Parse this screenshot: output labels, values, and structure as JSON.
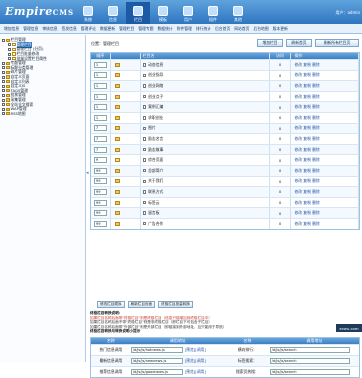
{
  "header": {
    "logo_main": "Empire",
    "logo_sub": "CMS",
    "user": "用户：admin",
    "nav": [
      {
        "label": "系统",
        "icon": "system-icon"
      },
      {
        "label": "信息",
        "icon": "info-icon"
      },
      {
        "label": "栏目",
        "icon": "column-icon"
      },
      {
        "label": "模板",
        "icon": "template-icon"
      },
      {
        "label": "用户",
        "icon": "user-icon"
      },
      {
        "label": "插件",
        "icon": "plugin-icon"
      },
      {
        "label": "其他",
        "icon": "other-icon"
      }
    ],
    "active_index": 2
  },
  "subnav": [
    "增加信息",
    "管理信息",
    "审核信息",
    "签发信息",
    "管理评论",
    "数据更新",
    "管理栏目",
    "管理专题",
    "数据统计",
    "附件管理",
    "排行统计",
    "后台首页",
    "网站首页",
    "后台地图",
    "版本更新"
  ],
  "sidebar": {
    "items": [
      {
        "label": "栏目管理",
        "level": 0,
        "type": "folder"
      },
      {
        "label": "管理栏目",
        "level": 1,
        "type": "doc"
      },
      {
        "label": "管理栏目 (分页)",
        "level": 1,
        "type": "doc"
      },
      {
        "label": "栏目批量修改",
        "level": 1,
        "type": "doc"
      },
      {
        "label": "批量设置栏目属性",
        "level": 1,
        "type": "doc"
      },
      {
        "label": "专题管理",
        "level": 0,
        "type": "folder"
      },
      {
        "label": "标题分类管理",
        "level": 0,
        "type": "folder"
      },
      {
        "label": "碎片管理",
        "level": 0,
        "type": "folder"
      },
      {
        "label": "自定义页面",
        "level": 0,
        "type": "folder"
      },
      {
        "label": "自定义列表",
        "level": 0,
        "type": "folder"
      },
      {
        "label": "自定义JS",
        "level": 0,
        "type": "folder"
      },
      {
        "label": "TAGS管理",
        "level": 0,
        "type": "folder"
      },
      {
        "label": "投票管理",
        "level": 0,
        "type": "folder"
      },
      {
        "label": "采集管理",
        "level": 0,
        "type": "folder"
      },
      {
        "label": "全站全文搜索",
        "level": 0,
        "type": "folder"
      },
      {
        "label": "WAP管理",
        "level": 0,
        "type": "folder"
      },
      {
        "label": "RSS地图",
        "level": 0,
        "type": "folder"
      }
    ]
  },
  "toolbar": {
    "crumb": "位置：管理栏目",
    "btn_add": "增加栏目",
    "btn_refresh": "刷新首页",
    "btn_all": "刷新所有栏目页"
  },
  "grid": {
    "headers": [
      "顺序",
      "",
      "栏目名",
      "访问",
      "操作"
    ],
    "rows": [
      {
        "order": "1",
        "name": "动态信息",
        "visits": "0",
        "ops": "修改 复制 删除"
      },
      {
        "order": "1",
        "name": "创业指导",
        "visits": "0",
        "ops": "修改 复制 删除"
      },
      {
        "order": "1",
        "name": "创业网络",
        "visits": "0",
        "ops": "修改 复制 删除"
      },
      {
        "order": "1",
        "name": "创业点子",
        "visits": "0",
        "ops": "修改 复制 删除"
      },
      {
        "order": "1",
        "name": "案例汇编",
        "visits": "0",
        "ops": "修改 复制 删除"
      },
      {
        "order": "1",
        "name": "求职创业",
        "visits": "0",
        "ops": "修改 复制 删除"
      },
      {
        "order": "7",
        "name": "图片",
        "visits": "0",
        "ops": "修改 复制 删除"
      },
      {
        "order": "7",
        "name": "励志名言",
        "visits": "0",
        "ops": "修改 复制 删除"
      },
      {
        "order": "7",
        "name": "励志故事",
        "visits": "0",
        "ops": "修改 复制 删除"
      },
      {
        "order": "9",
        "name": "综合页面",
        "visits": "0",
        "ops": "修改 复制 删除"
      },
      {
        "order": "99",
        "name": "总部简介",
        "visits": "0",
        "ops": "修改 复制 删除"
      },
      {
        "order": "99",
        "name": "关于我们",
        "visits": "0",
        "ops": "修改 复制 删除"
      },
      {
        "order": "99",
        "name": "联系方式",
        "visits": "0",
        "ops": "修改 复制 删除"
      },
      {
        "order": "99",
        "name": "标签云",
        "visits": "0",
        "ops": "修改 复制 删除"
      },
      {
        "order": "99",
        "name": "留言板",
        "visits": "0",
        "ops": "修改 复制 删除"
      },
      {
        "order": "99",
        "name": "广告合作",
        "visits": "0",
        "ops": "修改 复制 删除"
      }
    ]
  },
  "buttons": {
    "b1": "修改栏目顺序",
    "b2": "刷新栏目页面",
    "b3": "终极栏目批量转换"
  },
  "notes": {
    "title": "终极栏目转换说明：",
    "line1": "如果栏目名称后面带\"终极栏目\"则是终极栏目（信息只能增加到终极栏目中）",
    "line2": "如果栏目名称后面不带\"终极栏目\"则是非终极栏目（即栏目下可包含子栏目）",
    "line3": "如果栏目名称后面带\"外部栏目\"则是外部栏目（即链接到外部地址，且只能用于导航）",
    "line4": "终极栏目转换与转换说明小提示"
  },
  "tag_label": "ezwu.com",
  "settings": {
    "headers": [
      "名称",
      "调用地址",
      "名称",
      "调用地址"
    ],
    "rows": [
      {
        "n1": "热门信息调用",
        "v1": "/d/js/js/hotnews.js",
        "a1": "[预览][调用]",
        "n2": "横向排行：",
        "v2": "/d/js/js/search"
      },
      {
        "n1": "最新信息调用",
        "v1": "/d/js/js/newnews.js",
        "a1": "[预览][调用]",
        "n2": "标签搜索：",
        "v2": "/d/js/js/search"
      },
      {
        "n1": "推荐信息调用",
        "v1": "/d/js/js/goodnews.js",
        "a1": "[预览][调用]",
        "n2": "搜索页热搜：",
        "v2": "/d/js/js/search"
      }
    ]
  },
  "colors": {
    "accent": "#2f75c0",
    "header_dark": "#1d5aa5",
    "grid_header": "#3b7fc5",
    "link": "#2254a0",
    "note_red": "#c0392b"
  }
}
